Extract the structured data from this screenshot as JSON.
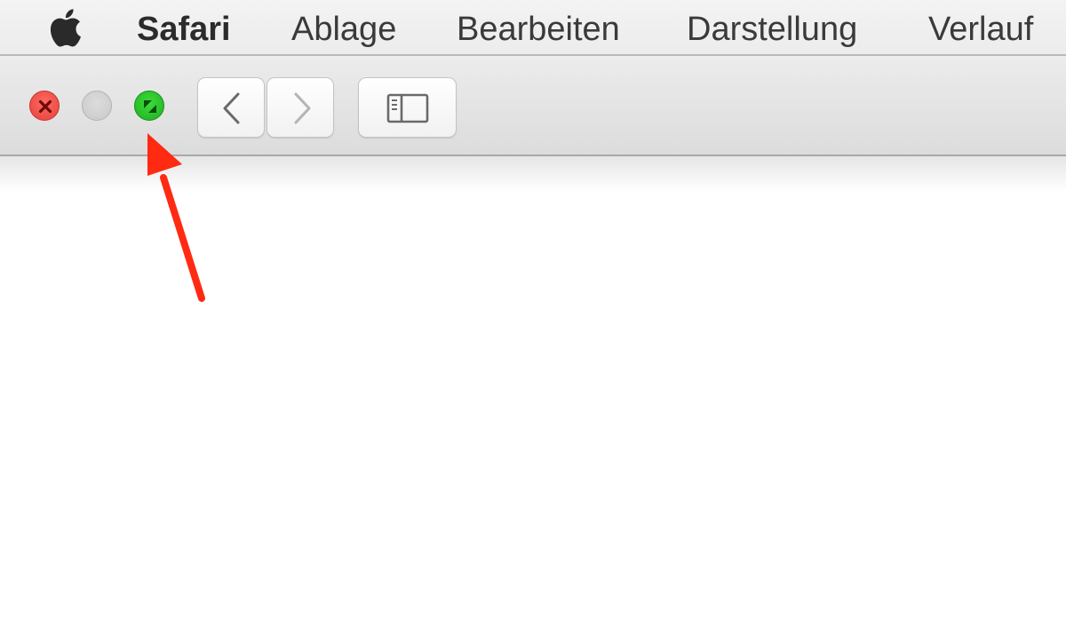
{
  "menubar": {
    "apple_icon": "apple-logo-icon",
    "app_name": "Safari",
    "items": [
      {
        "label": "Ablage"
      },
      {
        "label": "Bearbeiten"
      },
      {
        "label": "Darstellung"
      },
      {
        "label": "Verlauf"
      }
    ]
  },
  "toolbar": {
    "window_controls": {
      "close": {
        "icon": "close-icon",
        "color": "#ee4e46"
      },
      "minimize": {
        "icon": "minimize-icon",
        "color": "#d0d0d0",
        "enabled": false
      },
      "zoom": {
        "icon": "fullscreen-icon",
        "color": "#2bc52c"
      }
    },
    "buttons": [
      {
        "name": "back-button",
        "icon": "chevron-left-icon"
      },
      {
        "name": "forward-button",
        "icon": "chevron-right-icon"
      },
      {
        "name": "sidebar-toggle-button",
        "icon": "sidebar-icon"
      }
    ]
  },
  "annotation": {
    "type": "arrow",
    "color": "#ff2a12",
    "target": "zoom-button"
  }
}
